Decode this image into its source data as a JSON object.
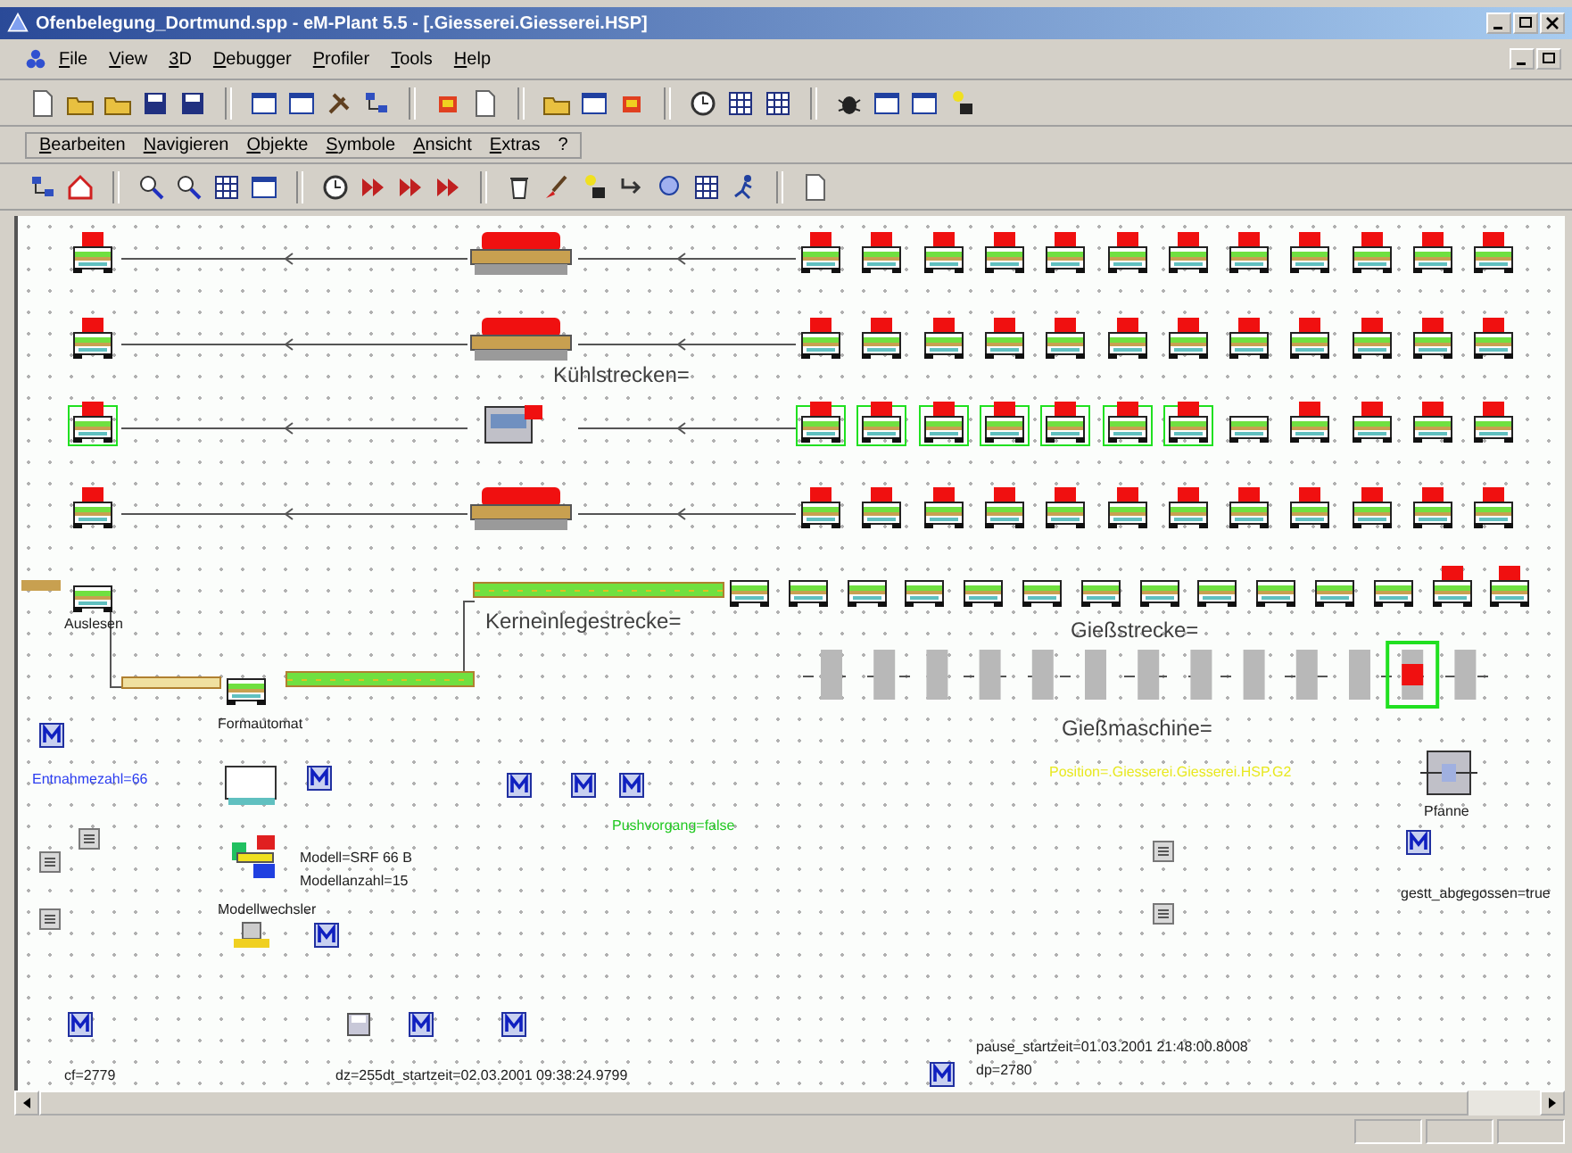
{
  "window": {
    "title": "Ofenbelegung_Dortmund.spp - eM-Plant 5.5 - [.Giesserei.Giesserei.HSP]"
  },
  "menu": [
    "File",
    "View",
    "3D",
    "Debugger",
    "Profiler",
    "Tools",
    "Help"
  ],
  "menu_2": [
    "Bearbeiten",
    "Navigieren",
    "Objekte",
    "Symbole",
    "Ansicht",
    "Extras",
    "?"
  ],
  "lines": [
    {
      "left": {
        "loaded": true,
        "selected": false
      },
      "middle": {
        "kind": "oven"
      },
      "right": [
        {
          "loaded": true,
          "selected": false
        },
        {
          "loaded": true,
          "selected": false
        },
        {
          "loaded": true,
          "selected": false
        },
        {
          "loaded": true,
          "selected": false
        },
        {
          "loaded": true,
          "selected": false
        },
        {
          "loaded": true,
          "selected": false
        },
        {
          "loaded": true,
          "selected": false
        },
        {
          "loaded": true,
          "selected": false
        },
        {
          "loaded": true,
          "selected": false
        },
        {
          "loaded": true,
          "selected": false
        },
        {
          "loaded": true,
          "selected": false
        },
        {
          "loaded": true,
          "selected": false
        }
      ]
    },
    {
      "left": {
        "loaded": true,
        "selected": false
      },
      "middle": {
        "kind": "oven"
      },
      "right": [
        {
          "loaded": true,
          "selected": false
        },
        {
          "loaded": true,
          "selected": false
        },
        {
          "loaded": true,
          "selected": false
        },
        {
          "loaded": true,
          "selected": false
        },
        {
          "loaded": true,
          "selected": false
        },
        {
          "loaded": true,
          "selected": false
        },
        {
          "loaded": true,
          "selected": false
        },
        {
          "loaded": true,
          "selected": false
        },
        {
          "loaded": true,
          "selected": false
        },
        {
          "loaded": true,
          "selected": false
        },
        {
          "loaded": true,
          "selected": false
        },
        {
          "loaded": true,
          "selected": false
        }
      ]
    },
    {
      "left": {
        "loaded": true,
        "selected": true
      },
      "middle": {
        "kind": "station"
      },
      "right": [
        {
          "loaded": true,
          "selected": true
        },
        {
          "loaded": true,
          "selected": true
        },
        {
          "loaded": true,
          "selected": true
        },
        {
          "loaded": true,
          "selected": true
        },
        {
          "loaded": true,
          "selected": true
        },
        {
          "loaded": true,
          "selected": true
        },
        {
          "loaded": true,
          "selected": true
        },
        {
          "loaded": false,
          "selected": false
        },
        {
          "loaded": true,
          "selected": false
        },
        {
          "loaded": true,
          "selected": false
        },
        {
          "loaded": true,
          "selected": false
        },
        {
          "loaded": true,
          "selected": false
        }
      ]
    },
    {
      "left": {
        "loaded": true,
        "selected": false
      },
      "middle": {
        "kind": "oven"
      },
      "right": [
        {
          "loaded": true,
          "selected": false
        },
        {
          "loaded": true,
          "selected": false
        },
        {
          "loaded": true,
          "selected": false
        },
        {
          "loaded": true,
          "selected": false
        },
        {
          "loaded": true,
          "selected": false
        },
        {
          "loaded": true,
          "selected": false
        },
        {
          "loaded": true,
          "selected": false
        },
        {
          "loaded": true,
          "selected": false
        },
        {
          "loaded": true,
          "selected": false
        },
        {
          "loaded": true,
          "selected": false
        },
        {
          "loaded": true,
          "selected": false
        },
        {
          "loaded": true,
          "selected": false
        }
      ]
    }
  ],
  "core_line": [
    {
      "loaded": false
    },
    {
      "loaded": false
    },
    {
      "loaded": false
    },
    {
      "loaded": false
    },
    {
      "loaded": false
    },
    {
      "loaded": false
    },
    {
      "loaded": false
    },
    {
      "loaded": false
    },
    {
      "loaded": false
    },
    {
      "loaded": false
    },
    {
      "loaded": false
    },
    {
      "loaded": false
    },
    {
      "loaded": true
    },
    {
      "loaded": true
    }
  ],
  "casting_slots": [
    {
      "selected": false
    },
    {
      "selected": false
    },
    {
      "selected": false
    },
    {
      "selected": false
    },
    {
      "selected": false
    },
    {
      "selected": false
    },
    {
      "selected": false
    },
    {
      "selected": false
    },
    {
      "selected": false
    },
    {
      "selected": false
    },
    {
      "selected": false
    },
    {
      "selected": true
    },
    {
      "selected": false
    }
  ],
  "labels": [
    {
      "text": "Kühlstrecken=",
      "color": "#404040"
    },
    {
      "text": "Auslesen",
      "color": "#202020"
    },
    {
      "text": "Formautomat",
      "color": "#202020"
    },
    {
      "text": "Kerneinlegestrecke=",
      "color": "#404040"
    },
    {
      "text": "Gießstrecke=",
      "color": "#404040"
    },
    {
      "text": "Gießmaschine=",
      "color": "#404040"
    },
    {
      "text": "Entnahmezahl=66",
      "color": "#2a3cf0"
    },
    {
      "text": "Modell=SRF 66 B",
      "color": "#202020"
    },
    {
      "text": "Modellanzahl=15",
      "color": "#202020"
    },
    {
      "text": "Modellwechsler",
      "color": "#202020"
    },
    {
      "text": "Pushvorgang=false",
      "color": "#22c822"
    },
    {
      "text": "Position=.Giesserei.Giesserei.HSP.G2",
      "color": "#e8e820"
    },
    {
      "text": "Pfanne",
      "color": "#202020"
    },
    {
      "text": "gestt_abgegossen=true",
      "color": "#202020"
    },
    {
      "text": "cf=2779",
      "color": "#202020"
    },
    {
      "text": "dz=255dt_startzeit=02.03.2001 09:38:24.9799",
      "color": "#202020"
    },
    {
      "text": "pause_startzeit=01.03.2001 21:48:00.8008",
      "color": "#202020"
    },
    {
      "text": "dp=2780",
      "color": "#202020"
    }
  ]
}
